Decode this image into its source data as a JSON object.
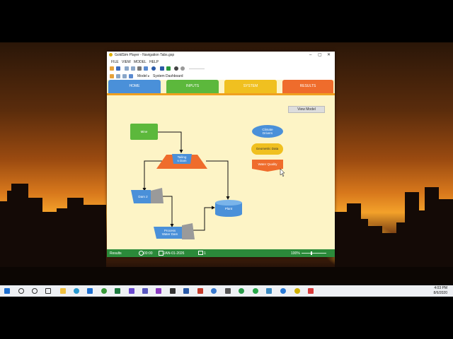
{
  "window": {
    "title": "GoldSim Player - Navigation Tabs.gsp",
    "min": "–",
    "max": "▢",
    "close": "✕"
  },
  "menu": [
    "FILE",
    "VIEW",
    "MODEL",
    "HELP"
  ],
  "breadcrumb": {
    "root": "Model",
    "sep": "▸",
    "current": "System Dashboard"
  },
  "tabs": [
    {
      "label": "HOME",
      "color": "#4a90d9"
    },
    {
      "label": "INPUTS",
      "color": "#5cb83c"
    },
    {
      "label": "SYSTEM",
      "color": "#f0c020"
    },
    {
      "label": "RESULTS",
      "color": "#ef6c2c"
    }
  ],
  "view_model_button": "View Model",
  "diagram": {
    "mine": "Mine",
    "tailing_dam": "Tailing\ns Dam",
    "dam2": "Dam 2",
    "process_water_dam": "Process\nWater Dam",
    "plant": "Plant",
    "climate_drivers": "Climate\nDrivers",
    "geometric_data": "Geometric Data",
    "water_quality": "Water Quality"
  },
  "status": {
    "results": "Results",
    "time": "00:00",
    "date": "JAN-01-2026",
    "count": "1",
    "zoom": "100%"
  },
  "clock": {
    "time": "4:03 PM",
    "date": "8/6/2020"
  },
  "colors": {
    "accent_green": "#2b8a3a",
    "canvas": "#fdf4c6"
  }
}
